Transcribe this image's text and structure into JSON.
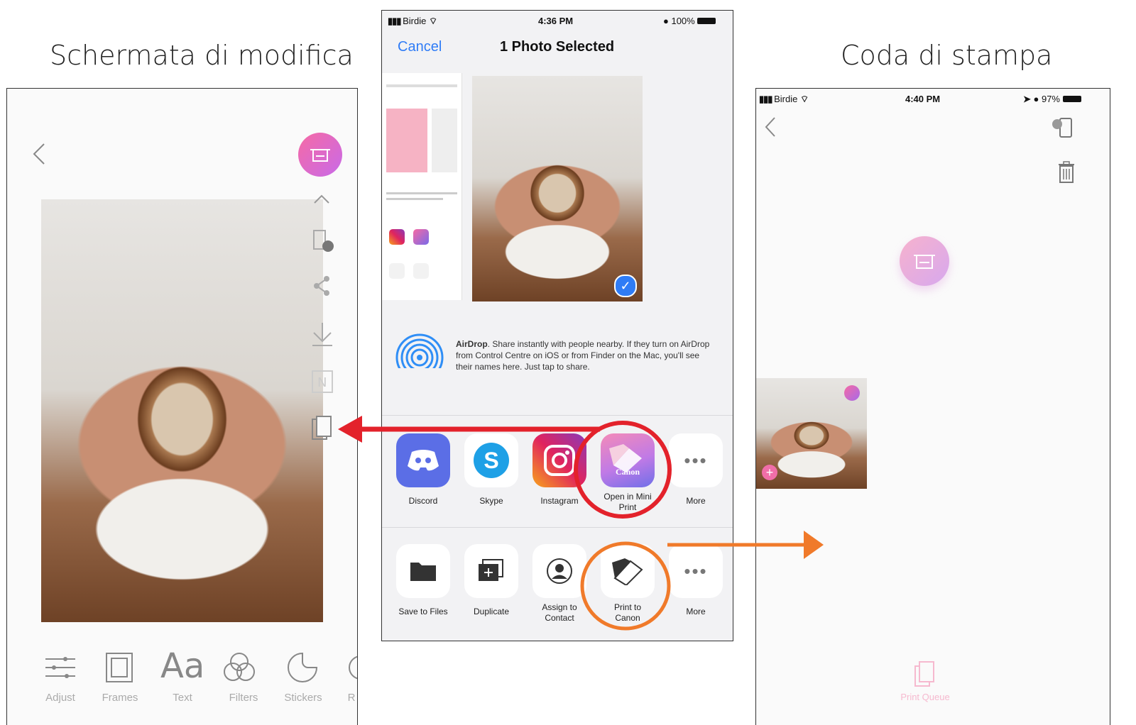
{
  "captions": {
    "left": "Schermata di modifica",
    "right": "Coda di stampa"
  },
  "edit_screen": {
    "toolbar": [
      "Adjust",
      "Frames",
      "Text",
      "Filters",
      "Stickers",
      "R"
    ],
    "text_tool_glyph": "Aa"
  },
  "share_sheet": {
    "status": {
      "carrier": "Birdie",
      "time": "4:36 PM",
      "battery": "100%"
    },
    "cancel": "Cancel",
    "title": "1 Photo Selected",
    "airdrop": {
      "label": "AirDrop",
      "text": ". Share instantly with people nearby. If they turn on AirDrop from Control Centre on iOS or from Finder on the Mac, you'll see their names here. Just tap to share."
    },
    "apps": [
      {
        "label": "Discord",
        "icon": "discord-icon"
      },
      {
        "label": "Skype",
        "icon": "skype-icon"
      },
      {
        "label": "Instagram",
        "icon": "instagram-icon"
      },
      {
        "label": "Open in Mini Print",
        "icon": "canon-mini-print-icon",
        "brand": "Canon"
      },
      {
        "label": "More",
        "icon": "more-icon"
      }
    ],
    "actions": [
      {
        "label": "Save to Files",
        "icon": "folder-icon"
      },
      {
        "label": "Duplicate",
        "icon": "duplicate-icon"
      },
      {
        "label": "Assign to Contact",
        "icon": "contact-icon"
      },
      {
        "label": "Print to Canon",
        "icon": "print-canon-icon"
      },
      {
        "label": "More",
        "icon": "more-icon"
      }
    ]
  },
  "print_queue": {
    "status": {
      "carrier": "Birdie",
      "time": "4:40 PM",
      "battery": "97%"
    },
    "tab_label": "Print Queue"
  },
  "colors": {
    "red_arrow": "#e3222b",
    "orange_arrow": "#f07a2a",
    "ios_blue": "#2f7cf6",
    "pink": "#ec5fa0",
    "purple": "#8a63e0"
  }
}
